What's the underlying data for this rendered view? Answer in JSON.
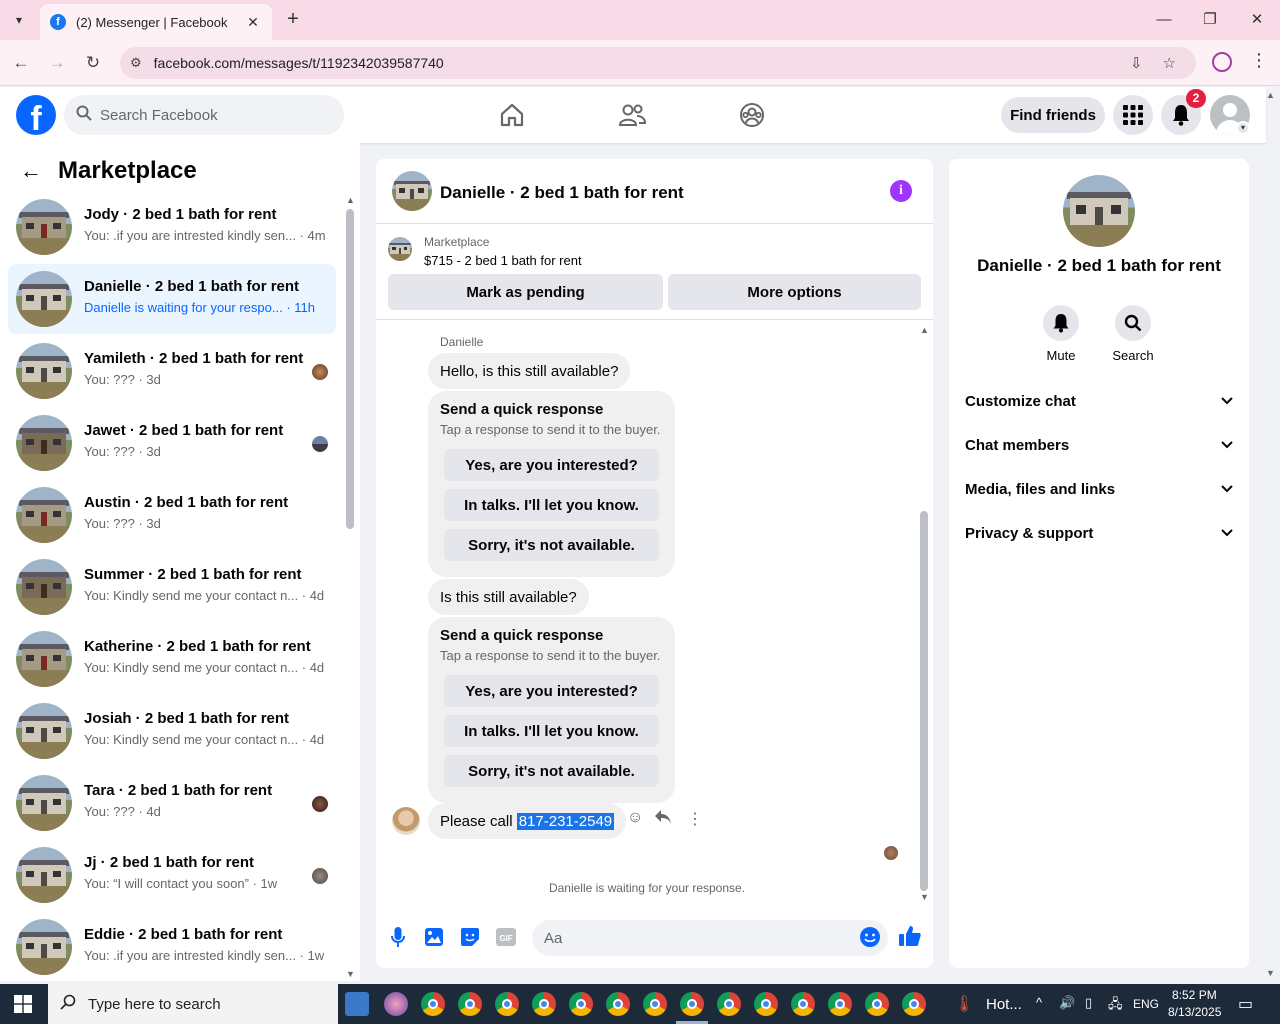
{
  "browser": {
    "tab_title": "(2) Messenger | Facebook",
    "url": "facebook.com/messages/t/1192342039587740",
    "tab_icon": "facebook-favicon",
    "accent": "#f9dbe8"
  },
  "header": {
    "search_placeholder": "Search Facebook",
    "find_friends": "Find friends",
    "notification_count": "2",
    "brand_color": "#0866ff"
  },
  "sidebar": {
    "title": "Marketplace",
    "conversations": [
      {
        "name": "Jody · 2 bed 1 bath for rent",
        "preview": "You: .if you are intrested kindly sen... · 4m",
        "active": false
      },
      {
        "name": "Danielle · 2 bed 1 bath for rent",
        "preview": "Danielle is waiting for your respo... · 11h",
        "active": true
      },
      {
        "name": "Yamileth · 2 bed 1 bath for rent",
        "preview": "You: ??? · 3d",
        "active": false
      },
      {
        "name": "Jawet · 2 bed 1 bath for rent",
        "preview": "You: ??? · 3d",
        "active": false
      },
      {
        "name": "Austin · 2 bed 1 bath for rent",
        "preview": "You: ??? · 3d",
        "active": false
      },
      {
        "name": "Summer · 2 bed 1 bath for rent",
        "preview": "You: Kindly send me your contact n... · 4d",
        "active": false
      },
      {
        "name": "Katherine · 2 bed 1 bath for rent",
        "preview": "You: Kindly send me your contact n... · 4d",
        "active": false
      },
      {
        "name": "Josiah · 2 bed 1 bath for rent",
        "preview": "You: Kindly send me your contact n... · 4d",
        "active": false
      },
      {
        "name": "Tara · 2 bed 1 bath for rent",
        "preview": "You: ??? · 4d",
        "active": false
      },
      {
        "name": "Jj · 2 bed 1 bath for rent",
        "preview": "You: “I will contact you soon” · 1w",
        "active": false
      },
      {
        "name": "Eddie · 2 bed 1 bath for rent",
        "preview": "You: .if you are intrested kindly sen... · 1w",
        "active": false
      }
    ]
  },
  "chat": {
    "title": "Danielle · 2 bed 1 bath for rent",
    "listing_kind": "Marketplace",
    "listing_price": "$715 - 2 bed 1 bath for rent",
    "mark_pending": "Mark as pending",
    "more_options": "More options",
    "sender": "Danielle",
    "messages": {
      "m1": "Hello, is this still available?",
      "m2": "Is this still available?",
      "last_prefix": "Please call ",
      "last_phone": "817-231-2549"
    },
    "quick_response": {
      "title": "Send a quick response",
      "subtitle": "Tap a response to send it to the buyer.",
      "options": [
        "Yes, are you interested?",
        "In talks. I'll let you know.",
        "Sorry, it's not available."
      ]
    },
    "waiting_text": "Danielle is waiting for your response.",
    "composer_placeholder": "Aa"
  },
  "info_panel": {
    "title": "Danielle · 2 bed 1 bath for rent",
    "mute": "Mute",
    "search": "Search",
    "sections": [
      "Customize chat",
      "Chat members",
      "Media, files and links",
      "Privacy & support"
    ]
  },
  "taskbar": {
    "search_placeholder": "Type here to search",
    "weather": "Hot...",
    "language": "ENG",
    "time": "8:52 PM",
    "date": "8/13/2025"
  }
}
